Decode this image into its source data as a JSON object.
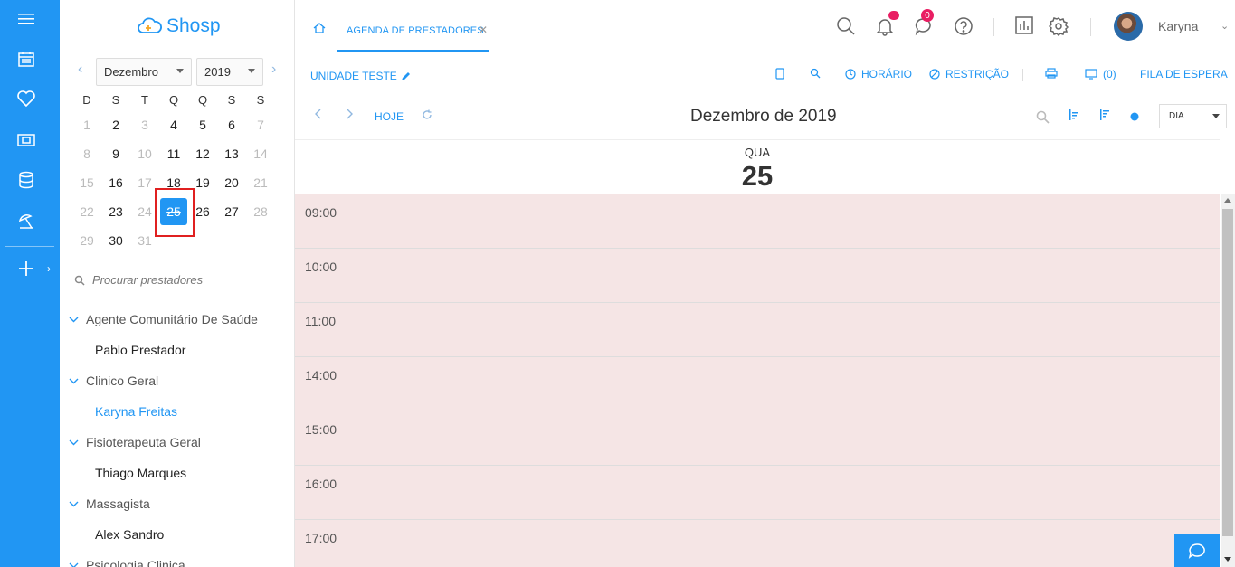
{
  "brand": {
    "name": "Shosp"
  },
  "calendar": {
    "month": "Dezembro",
    "year": "2019",
    "weekdays": [
      "D",
      "S",
      "T",
      "Q",
      "Q",
      "S",
      "S"
    ],
    "weeks": [
      [
        "1",
        "2",
        "3",
        "4",
        "5",
        "6",
        "7"
      ],
      [
        "8",
        "9",
        "10",
        "11",
        "12",
        "13",
        "14"
      ],
      [
        "15",
        "16",
        "17",
        "18",
        "19",
        "20",
        "21"
      ],
      [
        "22",
        "23",
        "24",
        "25",
        "26",
        "27",
        "28"
      ],
      [
        "29",
        "30",
        "31",
        "",
        "",
        "",
        ""
      ]
    ],
    "selected_day": "25"
  },
  "search": {
    "placeholder": "Procurar prestadores"
  },
  "groups": [
    {
      "name": "Agente Comunitário De Saúde",
      "providers": [
        "Pablo Prestador"
      ]
    },
    {
      "name": "Clinico Geral",
      "providers": [
        "Karyna Freitas"
      ]
    },
    {
      "name": "Fisioterapeuta Geral",
      "providers": [
        "Thiago Marques"
      ]
    },
    {
      "name": "Massagista",
      "providers": [
        "Alex Sandro"
      ]
    },
    {
      "name": "Psicologia Clinica",
      "providers": []
    }
  ],
  "active_provider": "Karyna Freitas",
  "header": {
    "tab_label": "AGENDA DE PRESTADORES",
    "messages_badge": "0",
    "user_name": "Karyna"
  },
  "toolbar": {
    "unit": "UNIDADE TESTE",
    "horario": "HORÁRIO",
    "restricao": "RESTRIÇÃO",
    "monitor_count": "(0)",
    "fila": "FILA DE ESPERA",
    "hoje": "HOJE",
    "title": "Dezembro de 2019",
    "view": "DIA"
  },
  "day": {
    "dow": "QUA",
    "num": "25"
  },
  "slots": [
    "09:00",
    "10:00",
    "11:00",
    "14:00",
    "15:00",
    "16:00",
    "17:00"
  ],
  "colors": {
    "primary": "#2196f3",
    "badge": "#e91e63",
    "grid": "#f5e5e5"
  }
}
